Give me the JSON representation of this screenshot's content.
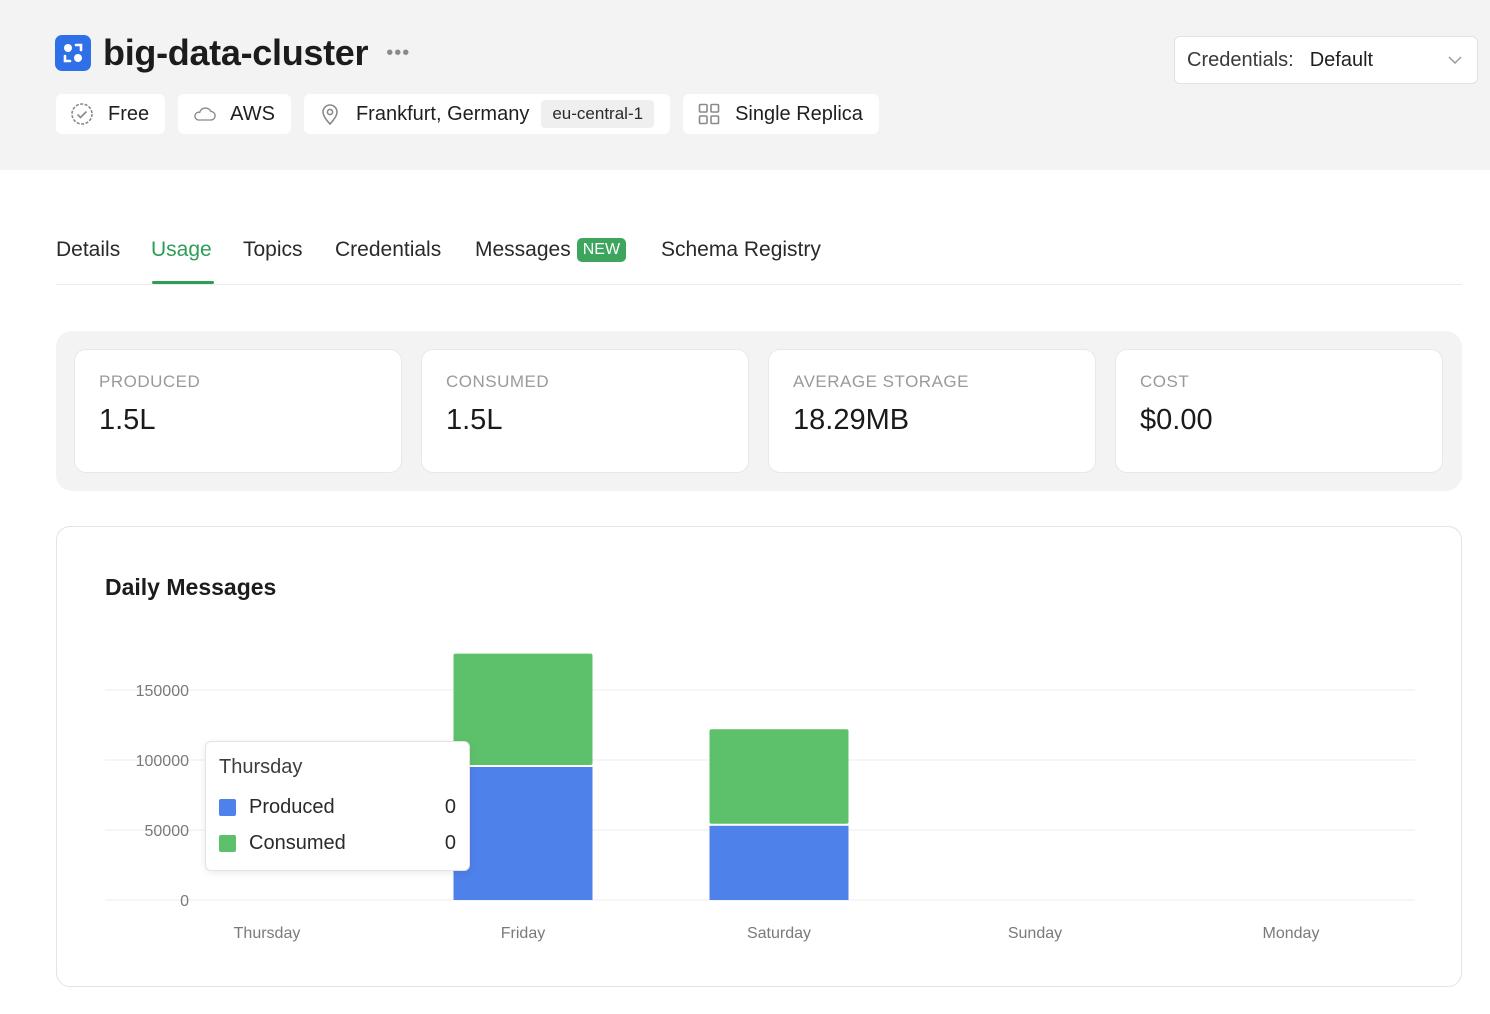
{
  "header": {
    "cluster_name": "big-data-cluster",
    "chips": {
      "plan": "Free",
      "provider": "AWS",
      "location": "Frankfurt, Germany",
      "region_code": "eu-central-1",
      "replication": "Single Replica"
    },
    "credentials": {
      "label": "Credentials:",
      "value": "Default"
    }
  },
  "tabs": [
    {
      "label": "Details",
      "active": false
    },
    {
      "label": "Usage",
      "active": true
    },
    {
      "label": "Topics",
      "active": false
    },
    {
      "label": "Credentials",
      "active": false
    },
    {
      "label": "Messages",
      "badge": "NEW",
      "active": false
    },
    {
      "label": "Schema Registry",
      "active": false
    }
  ],
  "stats": [
    {
      "label": "PRODUCED",
      "value": "1.5L"
    },
    {
      "label": "CONSUMED",
      "value": "1.5L"
    },
    {
      "label": "AVERAGE STORAGE",
      "value": "18.29MB"
    },
    {
      "label": "COST",
      "value": "$0.00"
    }
  ],
  "colors": {
    "produced": "#4f81ea",
    "consumed": "#5dc16b",
    "accent": "#2e9e57"
  },
  "tooltip": {
    "day": "Thursday",
    "rows": [
      {
        "name": "Produced",
        "value": "0"
      },
      {
        "name": "Consumed",
        "value": "0"
      }
    ]
  },
  "chart_data": {
    "type": "bar",
    "stacked": true,
    "title": "Daily Messages",
    "categories": [
      "Thursday",
      "Friday",
      "Saturday",
      "Sunday",
      "Monday"
    ],
    "series": [
      {
        "name": "Produced",
        "values": [
          0,
          95000,
          53000,
          0,
          0
        ]
      },
      {
        "name": "Consumed",
        "values": [
          0,
          81000,
          69000,
          0,
          0
        ]
      }
    ],
    "yticks": [
      "0",
      "50000",
      "100000",
      "150000"
    ],
    "ylim": [
      0,
      150000
    ],
    "grid": true,
    "xlabel": "",
    "ylabel": ""
  }
}
